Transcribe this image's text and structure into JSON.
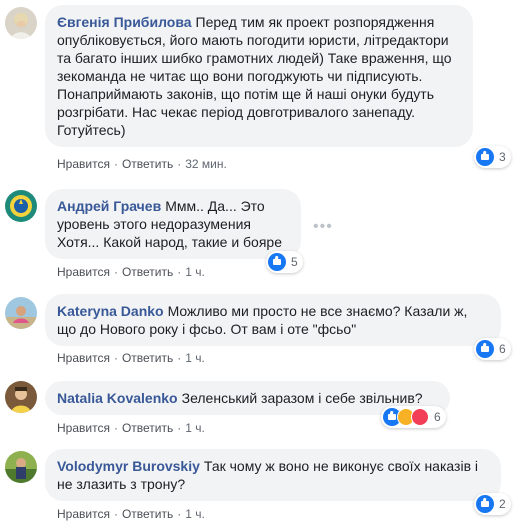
{
  "comments": [
    {
      "author": "Євгенія Прибилова",
      "text": "Перед тим як проект розпорядження опубліковується, його мають погодити юристи, літредактори та багато інших шибко грамотних людей) Таке враження, що зекоманда не читає що вони погоджують чи підписують. Понаприймають законів, що потім ще й наші онуки будуть розгрібати. Нас чекає період довготривалого занепаду. Готуйтесь)",
      "like": "Нравится",
      "reply": "Ответить",
      "time": "32 мин.",
      "reactions": "3"
    },
    {
      "author": "Андрей Грачев",
      "text": "Ммм.. Да... Это уровень этого недоразумения Хотя... Какой народ, такие и бояре",
      "like": "Нравится",
      "reply": "Ответить",
      "time": "1 ч.",
      "reactions": "5"
    },
    {
      "author": "Kateryna Danko",
      "text": "Можливо ми просто не все знаємо? Казали ж, що до Нового року і фсьо. От вам і оте \"фсьо\"",
      "like": "Нравится",
      "reply": "Ответить",
      "time": "1 ч.",
      "reactions": "6"
    },
    {
      "author": "Natalia Kovalenko",
      "text": "Зеленський заразом і себе звільнив?",
      "like": "Нравится",
      "reply": "Ответить",
      "time": "1 ч.",
      "reactions": "6"
    },
    {
      "author": "Volodymyr Burovskiy",
      "text": "Так чому ж воно не виконує своїх наказів і не злазить з трону?",
      "like": "Нравится",
      "reply": "Ответить",
      "time": "1 ч.",
      "reactions": "2"
    }
  ],
  "more_icon": "ellipsis-icon"
}
